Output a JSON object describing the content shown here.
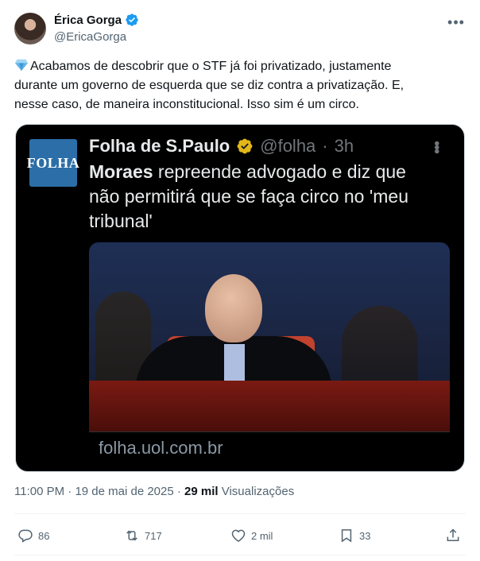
{
  "author": {
    "name": "Érica Gorga",
    "handle": "@EricaGorga",
    "verified": true
  },
  "tweet": {
    "emoji": "gem-icon",
    "lines": [
      "Acabamos de descobrir que o STF já foi privatizado, justamente",
      "durante um governo de esquerda que se diz contra a privatização. E,",
      "nesse caso, de maneira inconstitucional. Isso sim é um circo."
    ]
  },
  "card": {
    "logo_text": "FOLHA",
    "source_name": "Folha de S.Paulo",
    "source_handle": "@folha",
    "separator": "·",
    "source_time": "3h",
    "headline_strong": "Moraes",
    "headline_line1_rest": " repreende advogado e diz que",
    "headline_line2": "não permitirá que se faça circo no 'meu",
    "headline_line3": "tribunal'",
    "domain": "folha.uol.com.br"
  },
  "meta": {
    "time": "11:00 PM",
    "dot": " · ",
    "date": "19 de mai de 2025",
    "dot2": " · ",
    "views_count": "29 mil",
    "views_label": " Visualizações"
  },
  "actions": {
    "replies": "86",
    "reposts": "717",
    "likes": "2 mil",
    "bookmarks": "33"
  },
  "colors": {
    "verified_blue": "#1d9bf0",
    "verified_gold": "#e2b719",
    "folha_blue": "#2b6ea8",
    "secondary_text": "#536471"
  }
}
